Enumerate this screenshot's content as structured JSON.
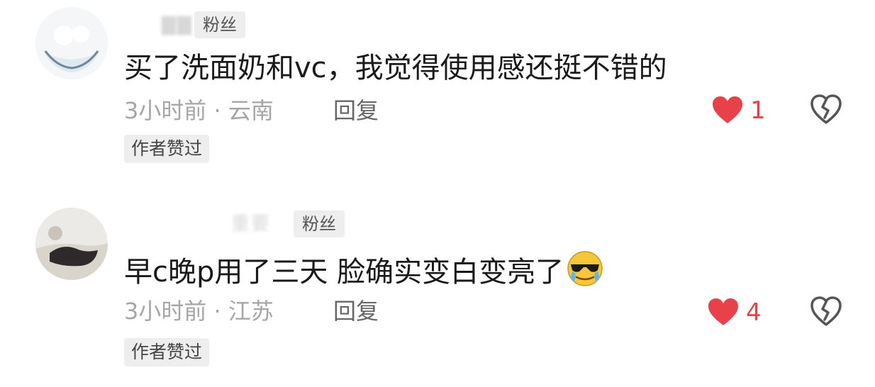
{
  "comments": [
    {
      "badge": "粉丝",
      "text": "买了洗面奶和vc，我觉得使用感还挺不错的",
      "time_location": "3小时前 · 云南",
      "reply_label": "回复",
      "like_count": "1",
      "author_liked": "作者赞过"
    },
    {
      "username": "重要",
      "badge": "粉丝",
      "text": "早c晚p用了三天 脸确实变白变亮了",
      "time_location": "3小时前 · 江苏",
      "reply_label": "回复",
      "like_count": "4",
      "author_liked": "作者赞过"
    }
  ],
  "colors": {
    "like": "#e8414a",
    "meta": "#a6a6a6",
    "badge_bg": "#eeeeee"
  },
  "icons": {
    "like": "heart-icon",
    "dislike": "broken-heart-icon",
    "emoji": "cool-crying-emoji-icon"
  }
}
